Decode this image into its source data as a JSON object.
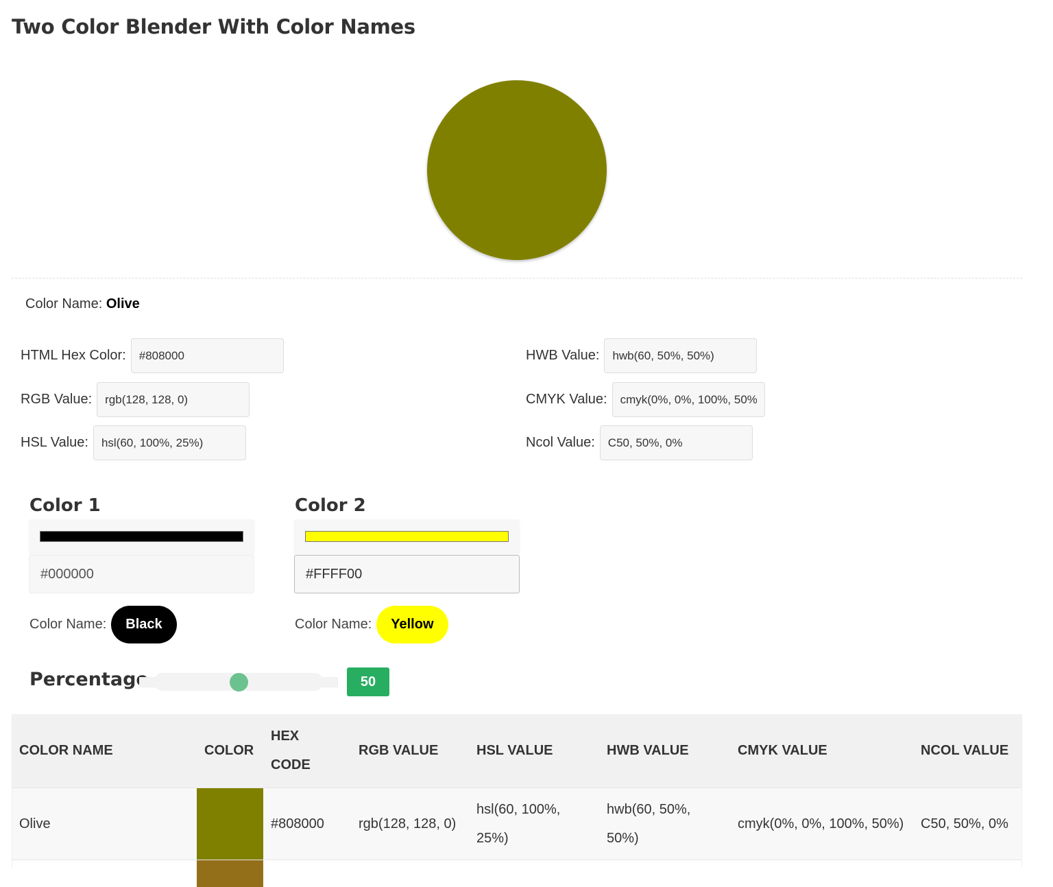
{
  "page": {
    "title": "Two Color Blender With Color Names"
  },
  "result": {
    "color": "#808000",
    "color_name_label": "Color Name:",
    "color_name": "Olive",
    "fields": {
      "hex": {
        "label": "HTML Hex Color:",
        "value": "#808000"
      },
      "rgb": {
        "label": "RGB Value:",
        "value": "rgb(128, 128, 0)"
      },
      "hsl": {
        "label": "HSL Value:",
        "value": "hsl(60, 100%, 25%)"
      },
      "hwb": {
        "label": "HWB Value:",
        "value": "hwb(60, 50%, 50%)"
      },
      "cmyk": {
        "label": "CMYK Value:",
        "value": "cmyk(0%, 0%, 100%, 50%)"
      },
      "ncol": {
        "label": "Ncol Value:",
        "value": "C50, 50%, 0%"
      }
    }
  },
  "color1": {
    "heading": "Color 1",
    "hex": "#000000",
    "swatch": "#000000",
    "name_label": "Color Name:",
    "name": "Black",
    "pill_bg": "#000000",
    "pill_fg": "#ffffff"
  },
  "color2": {
    "heading": "Color 2",
    "hex": "#FFFF00",
    "swatch": "#ffff00",
    "name_label": "Color Name:",
    "name": "Yellow",
    "pill_bg": "#ffff00",
    "pill_fg": "#000000"
  },
  "percentage": {
    "label": "Percentage",
    "value": 50,
    "value_text": "50",
    "min": 0,
    "max": 100,
    "badge_color": "#27ae60",
    "thumb_color": "#6cc28e"
  },
  "table": {
    "headers": {
      "name": "COLOR NAME",
      "color": "COLOR",
      "hex_line1": "HEX",
      "hex_line2": "CODE",
      "rgb": "RGB VALUE",
      "hsl": "HSL VALUE",
      "hwb": "HWB VALUE",
      "cmyk": "CMYK VALUE",
      "ncol": "NCOL VALUE"
    },
    "rows": [
      {
        "name": "Olive",
        "swatch": "#808000",
        "hex": "#808000",
        "rgb": "rgb(128, 128, 0)",
        "hsl": "hsl(60, 100%, 25%)",
        "hwb": "hwb(60, 50%, 50%)",
        "cmyk": "cmyk(0%, 0%, 100%, 50%)",
        "ncol": "C50, 50%, 0%"
      },
      {
        "swatch": "#946f1a"
      }
    ]
  }
}
